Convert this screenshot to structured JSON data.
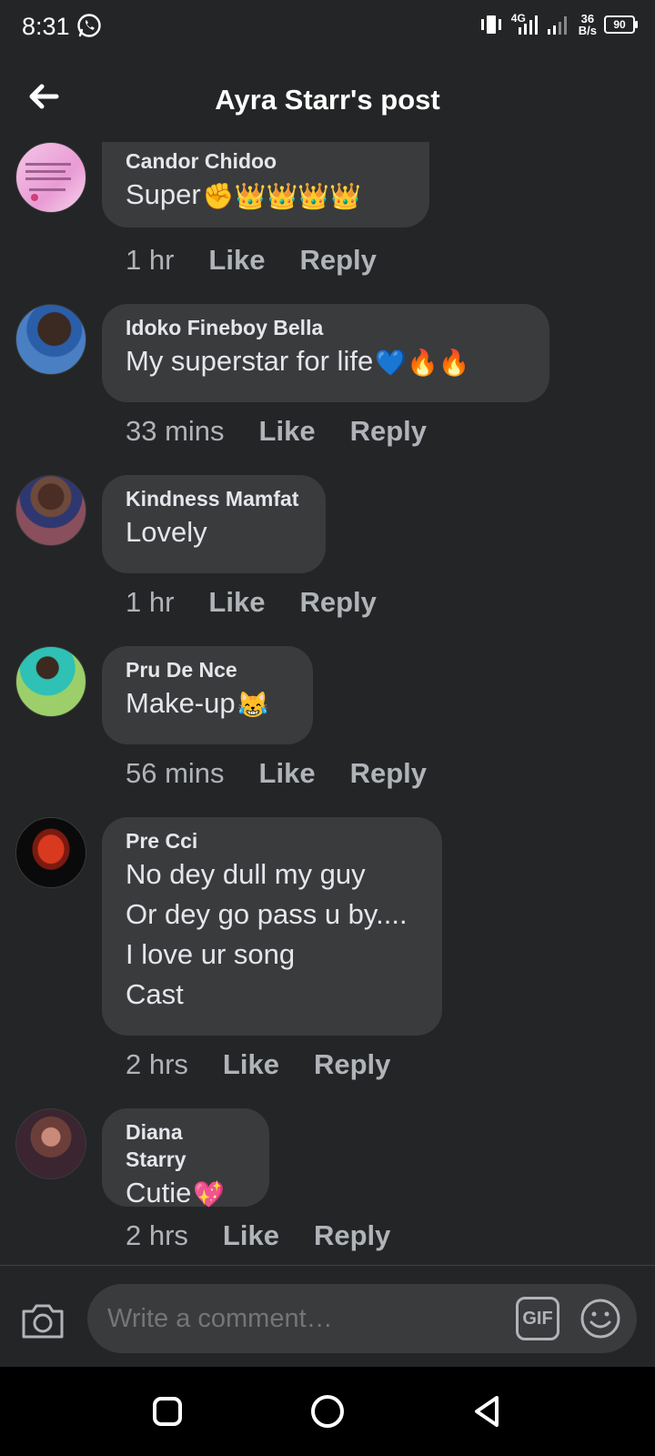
{
  "status": {
    "time": "8:31",
    "network": "4G",
    "speed_value": "36",
    "speed_unit": "B/s",
    "battery": "90"
  },
  "header": {
    "title": "Ayra Starr's post"
  },
  "comments": [
    {
      "name": "Candor Chidoo",
      "text": "Super",
      "emoji": "✊👑👑👑👑",
      "time": "1 hr",
      "like": "Like",
      "reply": "Reply"
    },
    {
      "name": "Idoko Fineboy Bella",
      "text": "My superstar for life",
      "emoji": "💙🔥🔥",
      "time": "33 mins",
      "like": "Like",
      "reply": "Reply"
    },
    {
      "name": "Kindness Mamfat",
      "text": "Lovely",
      "emoji": "",
      "time": "1 hr",
      "like": "Like",
      "reply": "Reply"
    },
    {
      "name": "Pru De Nce",
      "text": "Make-up",
      "emoji": "😹",
      "time": "56 mins",
      "like": "Like",
      "reply": "Reply"
    },
    {
      "name": "Pre Cci",
      "text": "No dey dull my guy\nOr dey go pass u by....\nI love ur song\nCast",
      "emoji": "",
      "time": "2 hrs",
      "like": "Like",
      "reply": "Reply"
    },
    {
      "name": "Diana Starry",
      "text": "Cutie",
      "emoji": "💖",
      "time": "2 hrs",
      "like": "Like",
      "reply": "Reply"
    }
  ],
  "composer": {
    "placeholder": "Write a comment…",
    "gif_label": "GIF"
  },
  "colors": {
    "background": "#242526",
    "bubble": "#3a3b3c",
    "primary_text": "#e4e6eb",
    "secondary_text": "#b0b3b8"
  }
}
